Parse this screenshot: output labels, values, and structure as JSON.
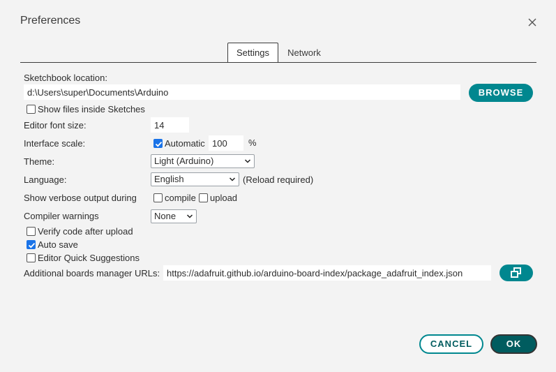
{
  "dialog": {
    "title": "Preferences"
  },
  "tabs": [
    {
      "label": "Settings",
      "active": true
    },
    {
      "label": "Network",
      "active": false
    }
  ],
  "sketchbook": {
    "label": "Sketchbook location:",
    "value": "d:\\Users\\super\\Documents\\Arduino",
    "browse_label": "BROWSE",
    "show_files_label": "Show files inside Sketches",
    "show_files_checked": false
  },
  "editor_font": {
    "label": "Editor font size:",
    "value": "14"
  },
  "interface_scale": {
    "label": "Interface scale:",
    "automatic_label": "Automatic",
    "automatic_checked": true,
    "value": "100",
    "unit": "%"
  },
  "theme": {
    "label": "Theme:",
    "value": "Light (Arduino)"
  },
  "language": {
    "label": "Language:",
    "value": "English",
    "note": "(Reload required)"
  },
  "verbose": {
    "label": "Show verbose output during",
    "compile_label": "compile",
    "compile_checked": false,
    "upload_label": "upload",
    "upload_checked": false
  },
  "compiler_warnings": {
    "label": "Compiler warnings",
    "value": "None"
  },
  "verify": {
    "label": "Verify code after upload",
    "checked": false
  },
  "autosave": {
    "label": "Auto save",
    "checked": true
  },
  "quick_suggestions": {
    "label": "Editor Quick Suggestions",
    "checked": false
  },
  "boards_urls": {
    "label": "Additional boards manager URLs:",
    "value": "https://adafruit.github.io/arduino-board-index/package_adafruit_index.json"
  },
  "footer": {
    "cancel_label": "CANCEL",
    "ok_label": "OK"
  },
  "colors": {
    "accent": "#00878f",
    "accent_dark": "#005c5f",
    "checkbox": "#1a73e8"
  }
}
